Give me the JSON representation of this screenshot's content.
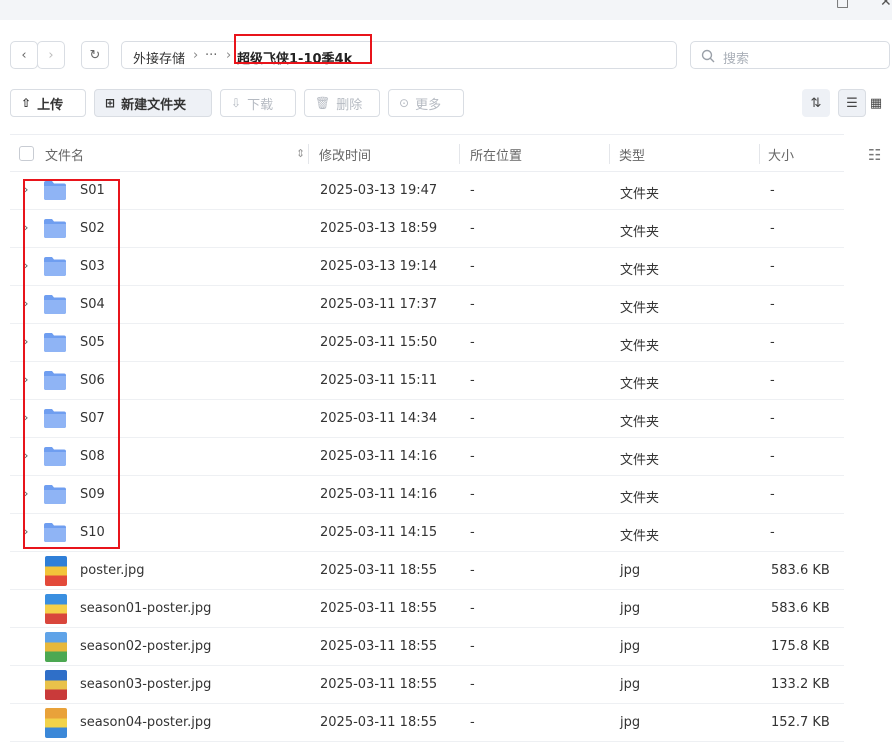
{
  "nav": {
    "back": "‹",
    "forward": "›",
    "refresh": "↻",
    "breadcrumb": {
      "root": "外接存储",
      "sep1": "›",
      "ellipsis": "···",
      "sep2": "›",
      "current": "超级飞侠1-10季4k"
    },
    "search_placeholder": "搜索"
  },
  "toolbar": {
    "upload": "上传",
    "new_folder": "新建文件夹",
    "download": "下载",
    "delete": "删除",
    "more": "更多"
  },
  "columns": {
    "name": "文件名",
    "modified": "修改时间",
    "location": "所在位置",
    "type": "类型",
    "size": "大小"
  },
  "folders": [
    {
      "name": "S01",
      "modified": "2025-03-13 19:47",
      "location": "-",
      "type": "文件夹",
      "size": "-"
    },
    {
      "name": "S02",
      "modified": "2025-03-13 18:59",
      "location": "-",
      "type": "文件夹",
      "size": "-"
    },
    {
      "name": "S03",
      "modified": "2025-03-13 19:14",
      "location": "-",
      "type": "文件夹",
      "size": "-"
    },
    {
      "name": "S04",
      "modified": "2025-03-11 17:37",
      "location": "-",
      "type": "文件夹",
      "size": "-"
    },
    {
      "name": "S05",
      "modified": "2025-03-11 15:50",
      "location": "-",
      "type": "文件夹",
      "size": "-"
    },
    {
      "name": "S06",
      "modified": "2025-03-11 15:11",
      "location": "-",
      "type": "文件夹",
      "size": "-"
    },
    {
      "name": "S07",
      "modified": "2025-03-11 14:34",
      "location": "-",
      "type": "文件夹",
      "size": "-"
    },
    {
      "name": "S08",
      "modified": "2025-03-11 14:16",
      "location": "-",
      "type": "文件夹",
      "size": "-"
    },
    {
      "name": "S09",
      "modified": "2025-03-11 14:16",
      "location": "-",
      "type": "文件夹",
      "size": "-"
    },
    {
      "name": "S10",
      "modified": "2025-03-11 14:15",
      "location": "-",
      "type": "文件夹",
      "size": "-"
    }
  ],
  "files": [
    {
      "name": "poster.jpg",
      "modified": "2025-03-11 18:55",
      "location": "-",
      "type": "jpg",
      "size": "583.6 KB"
    },
    {
      "name": "season01-poster.jpg",
      "modified": "2025-03-11 18:55",
      "location": "-",
      "type": "jpg",
      "size": "583.6 KB"
    },
    {
      "name": "season02-poster.jpg",
      "modified": "2025-03-11 18:55",
      "location": "-",
      "type": "jpg",
      "size": "175.8 KB"
    },
    {
      "name": "season03-poster.jpg",
      "modified": "2025-03-11 18:55",
      "location": "-",
      "type": "jpg",
      "size": "133.2 KB"
    },
    {
      "name": "season04-poster.jpg",
      "modified": "2025-03-11 18:55",
      "location": "-",
      "type": "jpg",
      "size": "152.7 KB"
    }
  ],
  "colors": {
    "highlight": "#e8141b",
    "folder": "#8fb4f5",
    "folder_tab": "#6f9ef0"
  }
}
